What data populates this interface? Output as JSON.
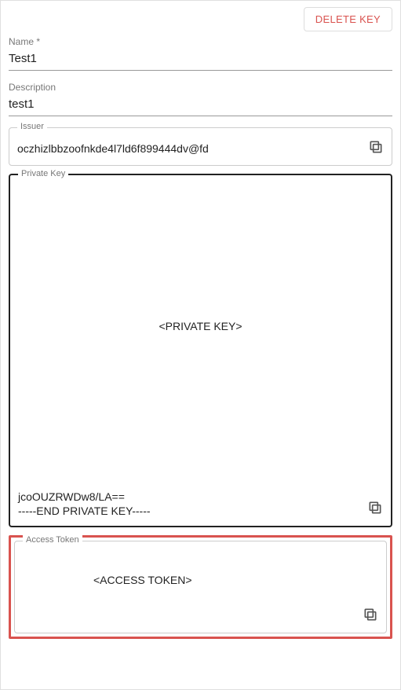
{
  "actions": {
    "delete_label": "DELETE KEY"
  },
  "fields": {
    "name": {
      "label": "Name *",
      "value": "Test1"
    },
    "description": {
      "label": "Description",
      "value": "test1"
    }
  },
  "issuer": {
    "label": "Issuer",
    "value": "oczhizlbbzoofnkde4l7ld6f899444dv@fd"
  },
  "private_key": {
    "label": "Private Key",
    "placeholder": "<PRIVATE KEY>",
    "tail_line1": "jcoOUZRWDw8/LA==",
    "tail_line2": "-----END PRIVATE KEY-----"
  },
  "access_token": {
    "label": "Access Token",
    "placeholder": "<ACCESS TOKEN>"
  },
  "icons": {
    "copy": "copy-icon"
  }
}
